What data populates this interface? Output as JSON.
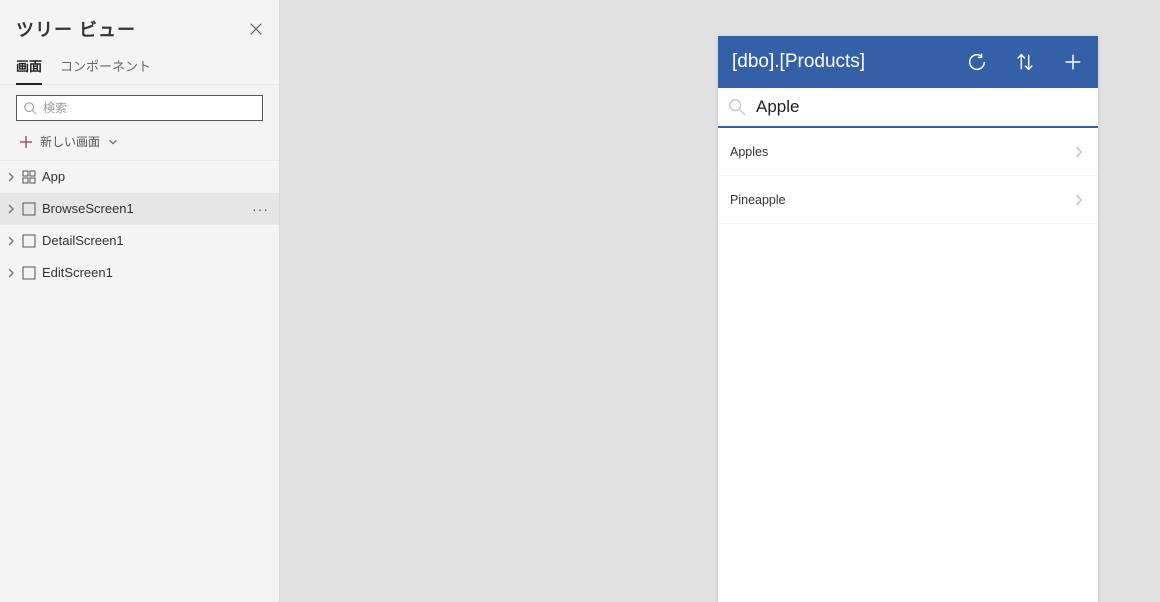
{
  "sidebar": {
    "title": "ツリー ビュー",
    "tabs": {
      "screens": "画面",
      "components": "コンポーネント"
    },
    "search_placeholder": "検索",
    "new_screen_label": "新しい画面",
    "items": [
      {
        "label": "App",
        "type": "app",
        "selected": false
      },
      {
        "label": "BrowseScreen1",
        "type": "screen",
        "selected": true
      },
      {
        "label": "DetailScreen1",
        "type": "screen",
        "selected": false
      },
      {
        "label": "EditScreen1",
        "type": "screen",
        "selected": false
      }
    ]
  },
  "preview": {
    "header_title": "[dbo].[Products]",
    "search_value": "Apple",
    "rows": [
      {
        "label": "Apples"
      },
      {
        "label": "Pineapple"
      }
    ]
  }
}
